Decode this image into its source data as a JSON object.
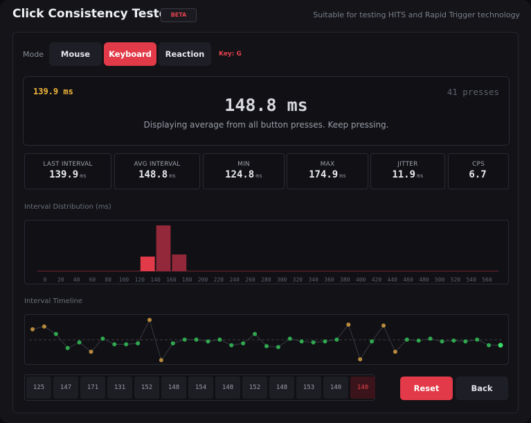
{
  "header": {
    "title": "Click Consistency Tester",
    "badge": "BETA",
    "subtitle": "Suitable for testing HITS and Rapid Trigger technology"
  },
  "mode": {
    "label": "Mode",
    "options": [
      "Mouse",
      "Keyboard",
      "Reaction"
    ],
    "selected": "Keyboard",
    "key_hint": "Key: G"
  },
  "display": {
    "last": "139.9 ms",
    "average": "148.8 ms",
    "presses": "41 presses",
    "description": "Displaying average from all button presses. Keep pressing."
  },
  "stats": [
    {
      "label": "LAST INTERVAL",
      "value": "139.9",
      "unit": "ms"
    },
    {
      "label": "AVG INTERVAL",
      "value": "148.8",
      "unit": "ms"
    },
    {
      "label": "MIN",
      "value": "124.8",
      "unit": "ms"
    },
    {
      "label": "MAX",
      "value": "174.9",
      "unit": "ms"
    },
    {
      "label": "JITTER",
      "value": "11.9",
      "unit": "ms"
    },
    {
      "label": "CPS",
      "value": "6.7",
      "unit": ""
    }
  ],
  "distribution": {
    "label": "Interval Distribution (ms)"
  },
  "timeline": {
    "label": "Interval Timeline"
  },
  "recent": [
    "125",
    "147",
    "171",
    "131",
    "152",
    "148",
    "154",
    "148",
    "152",
    "148",
    "153",
    "140",
    "140"
  ],
  "buttons": {
    "reset": "Reset",
    "back": "Back"
  },
  "colors": {
    "accent": "#e23a48",
    "last_value": "#f3b73a",
    "timeline_good": "#2fa84f",
    "timeline_off": "#b88a3c"
  },
  "chart_data": [
    {
      "type": "bar",
      "x_ticks": [
        0,
        20,
        40,
        60,
        80,
        100,
        120,
        140,
        160,
        180,
        200,
        220,
        240,
        260,
        280,
        300,
        320,
        340,
        360,
        380,
        400,
        420,
        440,
        460,
        480,
        500,
        520,
        540,
        560
      ],
      "bins": [
        {
          "start": 120,
          "end": 140,
          "count": 7
        },
        {
          "start": 140,
          "end": 160,
          "count": 22
        },
        {
          "start": 160,
          "end": 180,
          "count": 8
        }
      ],
      "xlim": [
        0,
        570
      ],
      "highlight_bin": 120
    },
    {
      "type": "scatter",
      "average": 148.8,
      "values": [
        160,
        163,
        155,
        140,
        146,
        136,
        150,
        144,
        144,
        145,
        170,
        127,
        145,
        149,
        149,
        147,
        149,
        143,
        145,
        155,
        142,
        141,
        150,
        147,
        146,
        147,
        149,
        165,
        128,
        147,
        164,
        136,
        149,
        148,
        150,
        147,
        148,
        147,
        149,
        143,
        143
      ]
    }
  ]
}
